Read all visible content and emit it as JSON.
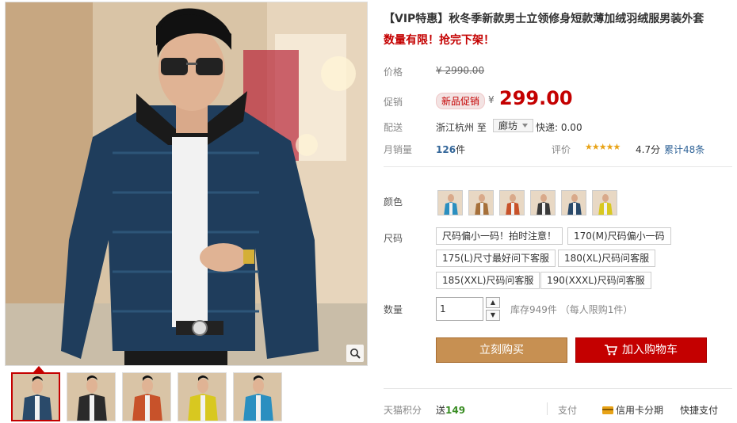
{
  "product": {
    "title": "【VIP特惠】秋冬季新款男士立领修身短款薄加绒羽绒服男装外套",
    "subtitle": "数量有限！抢完下架！"
  },
  "price": {
    "label": "价格",
    "original": "¥ 2990.00",
    "promo_label": "促销",
    "promo_badge": "新品促销",
    "currency": "¥",
    "current": "299.00"
  },
  "shipping": {
    "label": "配送",
    "from": "浙江杭州 至",
    "to": "廊坊",
    "fee": "快递: 0.00"
  },
  "sales": {
    "label": "月销量",
    "count": "126",
    "unit": "件",
    "review_label": "评价",
    "stars": "★★★★★",
    "score": "4.7分",
    "review_count": "累计48条"
  },
  "options": {
    "color_label": "颜色",
    "colors": [
      "#2a8fc0",
      "#a6703a",
      "#c8522a",
      "#3a3a3a",
      "#2a4a6a",
      "#d8c820"
    ],
    "size_label": "尺码",
    "sizes": [
      "尺码偏小一码！拍时注意！",
      "170(M)尺码偏小一码",
      "175(L)尺寸最好问下客服",
      "180(XL)尺码问客服",
      "185(XXL)尺码问客服",
      "190(XXXL)尺码问客服"
    ]
  },
  "quantity": {
    "label": "数量",
    "value": "1",
    "stock": "库存949件 （每人限购1件）"
  },
  "buttons": {
    "buy_now": "立刻购买",
    "add_cart": "加入购物车"
  },
  "footer": {
    "points_label": "天猫积分",
    "points_prefix": "送",
    "points_value": "149",
    "pay_label": "支付",
    "credit": "信用卡分期",
    "quickpay": "快捷支付"
  },
  "gallery": {
    "thumb_colors": [
      "#2a4a6a",
      "#2a2a2a",
      "#c8522a",
      "#d8c820",
      "#2a8fc0"
    ]
  },
  "colors": {
    "accent_red": "#c40000",
    "buy_now_bg": "#c79052",
    "star": "#e8a317",
    "link_blue": "#336699"
  }
}
